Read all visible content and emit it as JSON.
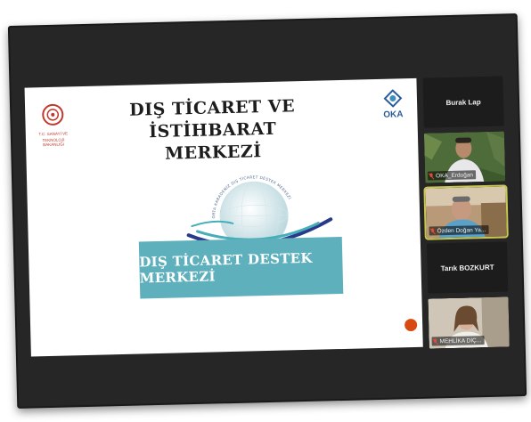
{
  "slide": {
    "title_line1": "DIŞ TİCARET VE İSTİHBARAT",
    "title_line2": "MERKEZİ",
    "banner_text": "DIŞ TİCARET DESTEK MERKEZİ",
    "ministry_text_line1": "T.C. SANAYİ VE",
    "ministry_text_line2": "TEKNOLOJİ BAKANLIĞI",
    "oka_label": "OKA",
    "globe_ring_text": "ORTA KARADENİZ DIŞ TİCARET DESTEK MERKEZİ",
    "colors": {
      "banner": "#5fb0bd",
      "ring_dark": "#2a3a8a",
      "ring_teal": "#46aeb8",
      "record": "#d94a12"
    }
  },
  "participants": [
    {
      "name": "Burak Lap",
      "type": "name-only"
    },
    {
      "name": "OKA_Erdoğan",
      "type": "video",
      "muted": true,
      "icon": "mic-muted-icon"
    },
    {
      "name": "Özden Doğan Ya...",
      "type": "video",
      "muted": true,
      "active_speaker": true,
      "icon": "mic-muted-icon"
    },
    {
      "name": "Tarık BOZKURT",
      "type": "name-only"
    },
    {
      "name": "MEHLİKA DİÇ...",
      "type": "video",
      "muted": true,
      "icon": "mic-muted-icon"
    }
  ]
}
